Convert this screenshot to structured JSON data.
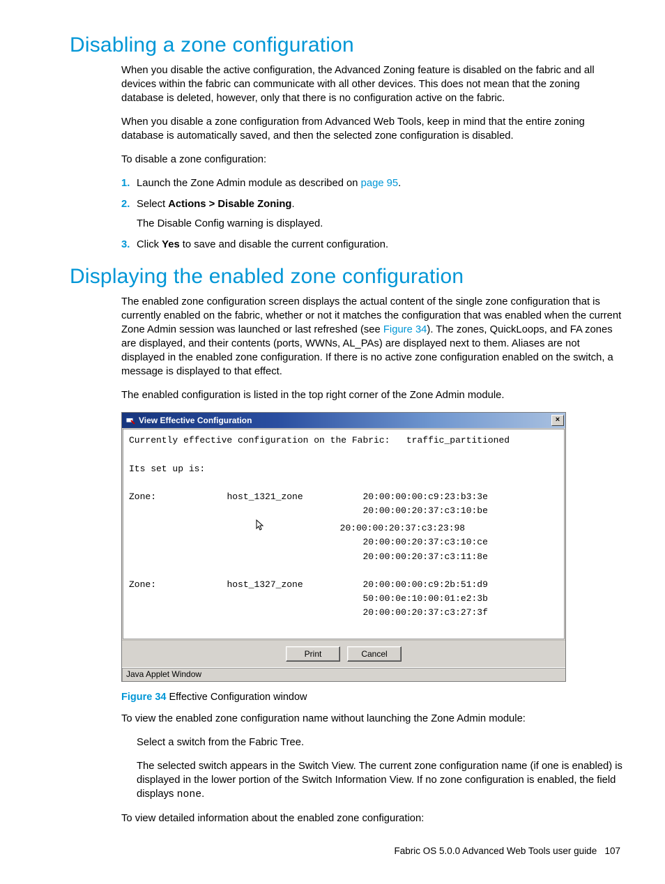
{
  "section1": {
    "heading": "Disabling a zone configuration",
    "p1": "When you disable the active configuration, the Advanced Zoning feature is disabled on the fabric and all devices within the fabric can communicate with all other devices. This does not mean that the zoning database is deleted, however, only that there is no configuration active on the fabric.",
    "p2": "When you disable a zone configuration from Advanced Web Tools, keep in mind that the entire zoning database is automatically saved, and then the selected zone configuration is disabled.",
    "p3": "To disable a zone configuration:",
    "steps": {
      "s1_a": "Launch the Zone Admin module as described on ",
      "s1_link": "page 95",
      "s1_b": ".",
      "s2_a": "Select ",
      "s2_bold": "Actions > Disable Zoning",
      "s2_b": ".",
      "s2_sub": "The Disable Config warning is displayed.",
      "s3_a": "Click ",
      "s3_bold": "Yes",
      "s3_b": " to save and disable the current configuration."
    }
  },
  "section2": {
    "heading": "Displaying the enabled zone configuration",
    "p1_a": "The enabled zone configuration screen displays the actual content of the single zone configuration that is currently enabled on the fabric, whether or not it matches the configuration that was enabled when the current Zone Admin session was launched or last refreshed (see ",
    "p1_link": "Figure 34",
    "p1_b": "). The zones, QuickLoops, and FA zones are displayed, and their contents (ports, WWNs, AL_PAs) are displayed next to them. Aliases are not displayed in the enabled zone configuration. If there is no active zone configuration enabled on the switch, a message is displayed to that effect.",
    "p2": "The enabled configuration is listed in the top right corner of the Zone Admin module."
  },
  "window": {
    "title": "View Effective Configuration",
    "close": "×",
    "line_current": "Currently effective configuration on the Fabric:   traffic_partitioned",
    "line_setup": "Its set up is:",
    "zone_label": "Zone:",
    "zone1_name": "host_1321_zone",
    "zone1_members": [
      "20:00:00:00:c9:23:b3:3e",
      "20:00:00:20:37:c3:10:be",
      "20:00:00:20:37:c3:23:98",
      "20:00:00:20:37:c3:10:ce",
      "20:00:00:20:37:c3:11:8e"
    ],
    "zone2_name": "host_1327_zone",
    "zone2_members": [
      "20:00:00:00:c9:2b:51:d9",
      "50:00:0e:10:00:01:e2:3b",
      "20:00:00:20:37:c3:27:3f"
    ],
    "btn_print": "Print",
    "btn_cancel": "Cancel",
    "status": "Java Applet Window"
  },
  "figure": {
    "label": "Figure 34",
    "caption": " Effective Configuration window"
  },
  "after": {
    "p1": "To view the enabled zone configuration name without launching the Zone Admin module:",
    "p2": "Select a switch from the Fabric Tree.",
    "p3_a": "The selected switch appears in the Switch View. The current zone configuration name (if one is enabled) is displayed in the lower portion of the Switch Information View. If no zone configuration is enabled, the field displays ",
    "p3_mono": "none",
    "p3_b": ".",
    "p4": "To view detailed information about the enabled zone configuration:"
  },
  "footer": {
    "text": "Fabric OS 5.0.0 Advanced Web Tools user guide",
    "page": "107"
  }
}
